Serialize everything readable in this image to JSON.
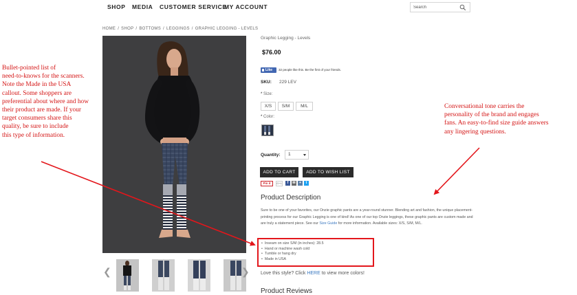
{
  "nav": {
    "items": [
      "SHOP",
      "MEDIA",
      "CUSTOMER SERVICE",
      "MY ACCOUNT"
    ],
    "search_placeholder": "Search"
  },
  "breadcrumb": [
    "HOME",
    "SHOP",
    "BOTTOMS",
    "LEGGINGS",
    "GRAPHIC LEGGING - LEVELS"
  ],
  "breadcrumb_separator": "/",
  "product": {
    "title": "Graphic Legging - Levels",
    "price": "$76.00",
    "facebook": {
      "like_label": "Like",
      "text": "32 people like this. Be the first of your friends."
    },
    "sku_label": "SKU:",
    "sku_value": "229 LEV",
    "size_label": "Size:",
    "sizes": [
      "X/S",
      "S/M",
      "M/L"
    ],
    "color_label": "Color:",
    "quantity_label": "Quantity:",
    "quantity_value": "1",
    "add_to_cart": "ADD TO CART",
    "add_to_wishlist": "ADD TO WISH LIST",
    "pin_label": "Pin it",
    "gplus_label": "G+1"
  },
  "description": {
    "heading": "Product Description",
    "text_part1": "Sure to be one of your favorites, our Onzie graphic pants are a year-round stunner. Blending art and fashion, the unique placement-printing process for our Graphic Legging is one of kind! As one of our top Onzie leggings, these graphic pants are custom made and are truly a statement piece. See our ",
    "size_guide_link": "Size Guide",
    "text_part2": " for more information. Available sizes: X/S, S/M, M/L.",
    "bullets": [
      "Inseam on size S/M (in inches): 28.5",
      "Hand or machine wash cold",
      "Tumble or hang dry",
      "Made in USA"
    ],
    "love_prefix": "Love this style? Click ",
    "love_link": "HERE",
    "love_suffix": " to view more colors!"
  },
  "reviews_heading": "Product Reviews",
  "annotations": {
    "left": [
      "Bullet-pointed list of",
      "need-to-knows for the scanners.",
      "Note the Made in the USA",
      "callout. Some shoppers are",
      "preferential about where and how",
      "their product are made. If your",
      "target consumers share this",
      "quality, be sure to include",
      "this type of information."
    ],
    "right": [
      "Conversational tone carries the",
      "personality of the brand and engages",
      "fans. An easy-to-find size guide answers",
      "any lingering questions."
    ]
  },
  "colors": {
    "annotation_red": "#e3161b",
    "link_blue": "#3a78c0",
    "button_dark": "#2b2b2b",
    "facebook_blue": "#4267b2"
  }
}
